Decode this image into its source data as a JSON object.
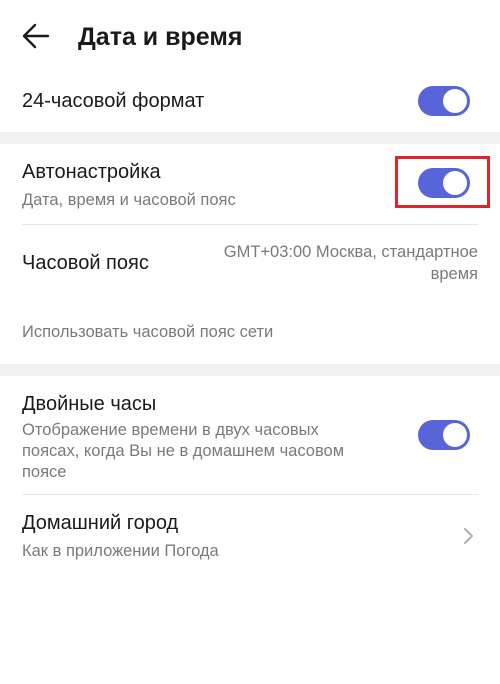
{
  "header": {
    "title": "Дата и время"
  },
  "settings": {
    "format24": {
      "label": "24-часовой формат",
      "enabled": true
    },
    "auto": {
      "label": "Автонастройка",
      "sublabel": "Дата, время и часовой пояс",
      "enabled": true
    },
    "timezone": {
      "label": "Часовой пояс",
      "value_line1": "GMT+03:00 Москва, стандартное",
      "value_line2": "время",
      "note": "Использовать часовой пояс сети"
    },
    "dual_clock": {
      "label": "Двойные часы",
      "sublabel_line1": "Отображение времени в двух часовых",
      "sublabel_line2": "поясах, когда Вы не в домашнем часовом",
      "sublabel_line3": "поясе",
      "enabled": true
    },
    "home_city": {
      "label": "Домашний город",
      "sublabel": "Как в приложении Погода"
    }
  },
  "colors": {
    "toggle_on": "#5865d8",
    "highlight": "#e0242b",
    "section_gap": "#f2f2f2"
  },
  "icons": {
    "back": "arrow-left-icon",
    "chevron": "chevron-right-icon"
  }
}
